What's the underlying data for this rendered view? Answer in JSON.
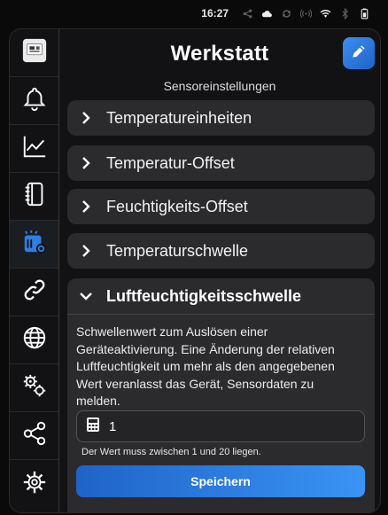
{
  "status_bar": {
    "time": "16:27",
    "icons": [
      "share-dots-icon",
      "cloud-icon",
      "sync-icon",
      "hotspot-icon",
      "wifi-icon",
      "bluetooth-icon",
      "battery-icon"
    ]
  },
  "header": {
    "title": "Werkstatt",
    "subtitle": "Sensoreinstellungen"
  },
  "sidebar": {
    "items": [
      {
        "name": "device-thumbnail",
        "icon": "sensor-device-image",
        "active": false
      },
      {
        "name": "alarms",
        "icon": "bell-icon",
        "active": false
      },
      {
        "name": "charts",
        "icon": "chart-line-icon",
        "active": false
      },
      {
        "name": "logs",
        "icon": "notebook-icon",
        "active": false
      },
      {
        "name": "sensor-settings",
        "icon": "sensor-gear-icon",
        "active": true
      },
      {
        "name": "links",
        "icon": "link-icon",
        "active": false
      },
      {
        "name": "network",
        "icon": "globe-icon",
        "active": false
      },
      {
        "name": "advanced",
        "icon": "gears-icon",
        "active": false
      },
      {
        "name": "share",
        "icon": "share-icon",
        "active": false
      },
      {
        "name": "settings",
        "icon": "gear-icon",
        "active": false
      }
    ]
  },
  "sections": [
    {
      "label": "Temperatureinheiten",
      "expanded": false
    },
    {
      "label": "Temperatur-Offset",
      "expanded": false
    },
    {
      "label": "Feuchtigkeits-Offset",
      "expanded": false
    },
    {
      "label": "Temperaturschwelle",
      "expanded": false
    }
  ],
  "open_section": {
    "label": "Luftfeuchtigkeitsschwelle",
    "description_lines": [
      "Schwellenwert zum Auslösen einer",
      "Geräteaktivierung. Eine Änderung der relativen",
      "Luftfeuchtigkeit um mehr als den angegebenen",
      "Wert veranlasst das Gerät, Sensordaten zu",
      "melden."
    ],
    "input_value": "1",
    "hint": "Der Wert muss zwischen 1 und 20 liegen.",
    "save_label": "Speichern"
  },
  "colors": {
    "accent": "#2f7ee0",
    "active_icon": "#2f7ee0",
    "card": "#2b2b2e",
    "background": "#121214"
  }
}
